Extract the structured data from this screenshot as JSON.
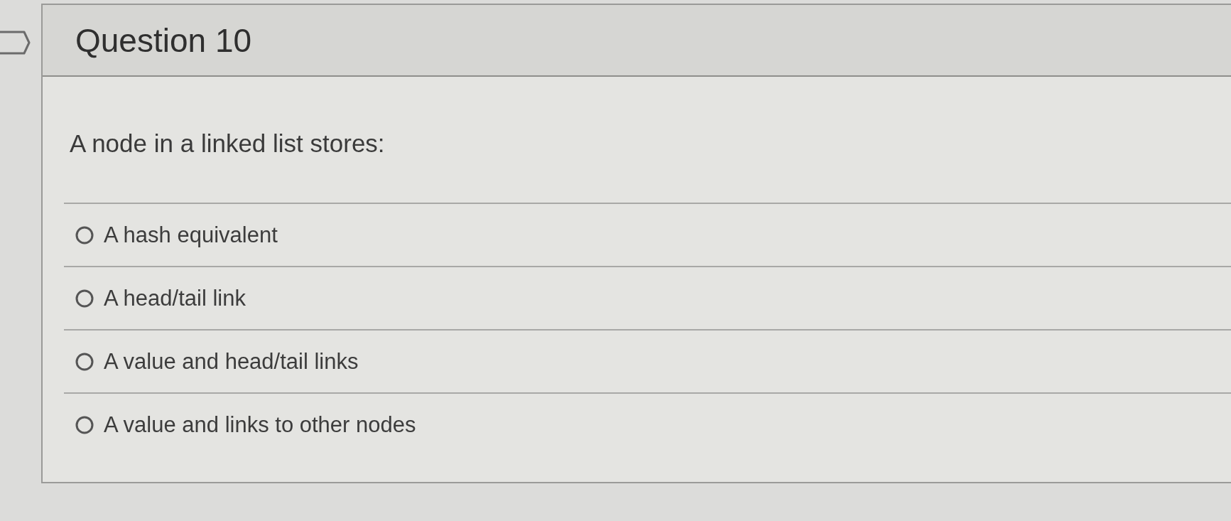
{
  "question": {
    "title": "Question 10",
    "prompt": "A node in a linked list stores:",
    "options": [
      {
        "label": "A hash equivalent",
        "selected": false
      },
      {
        "label": "A head/tail link",
        "selected": false
      },
      {
        "label": "A value and head/tail links",
        "selected": false
      },
      {
        "label": "A value and links to other nodes",
        "selected": false
      }
    ]
  }
}
